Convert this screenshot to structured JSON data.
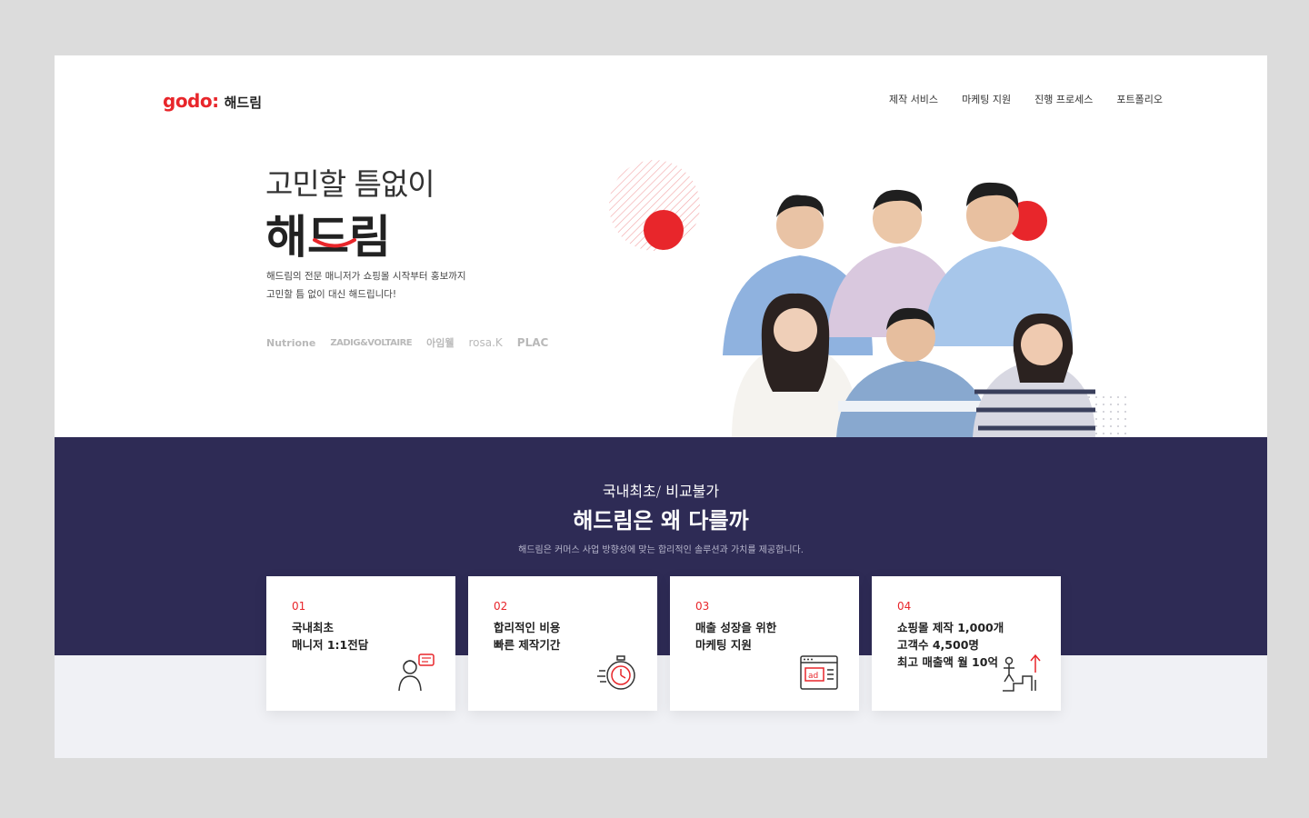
{
  "header": {
    "logo_mark": "godo:",
    "logo_text": "해드림",
    "nav": [
      "제작 서비스",
      "마케팅 지원",
      "진행 프로세스",
      "포트폴리오"
    ]
  },
  "hero": {
    "subtitle": "고민할 틈없이",
    "title": "해드림",
    "desc_line1": "해드림의 전문 매니저가 쇼핑몰 시작부터 홍보까지",
    "desc_line2": "고민할 틈 없이 대신 해드립니다!",
    "brands": [
      "Nutrione",
      "ZADIG&VOLTAIRE",
      "아임웰",
      "rosa.K",
      "PLAC"
    ]
  },
  "section": {
    "subtitle": "국내최초/ 비교불가",
    "title": "해드림은 왜 다를까",
    "desc": "해드림은 커머스 사업 방향성에 맞는 합리적인 솔루션과 가치를 제공합니다."
  },
  "cards": [
    {
      "num": "01",
      "text": "국내최초\n매니저 1:1전담",
      "icon": "consultant-icon"
    },
    {
      "num": "02",
      "text": "합리적인 비용\n빠른 제작기간",
      "icon": "stopwatch-icon"
    },
    {
      "num": "03",
      "text": "매출 성장을 위한\n마케팅 지원",
      "icon": "ad-browser-icon"
    },
    {
      "num": "04",
      "text": "쇼핑몰 제작 1,000개\n고객수 4,500명\n최고 매출액 월 10억",
      "icon": "growth-stairs-icon"
    }
  ],
  "colors": {
    "accent": "#e8262b",
    "navy": "#2e2b55",
    "grey_bg": "#f0f1f5",
    "page_bg": "#dcdcdc"
  }
}
